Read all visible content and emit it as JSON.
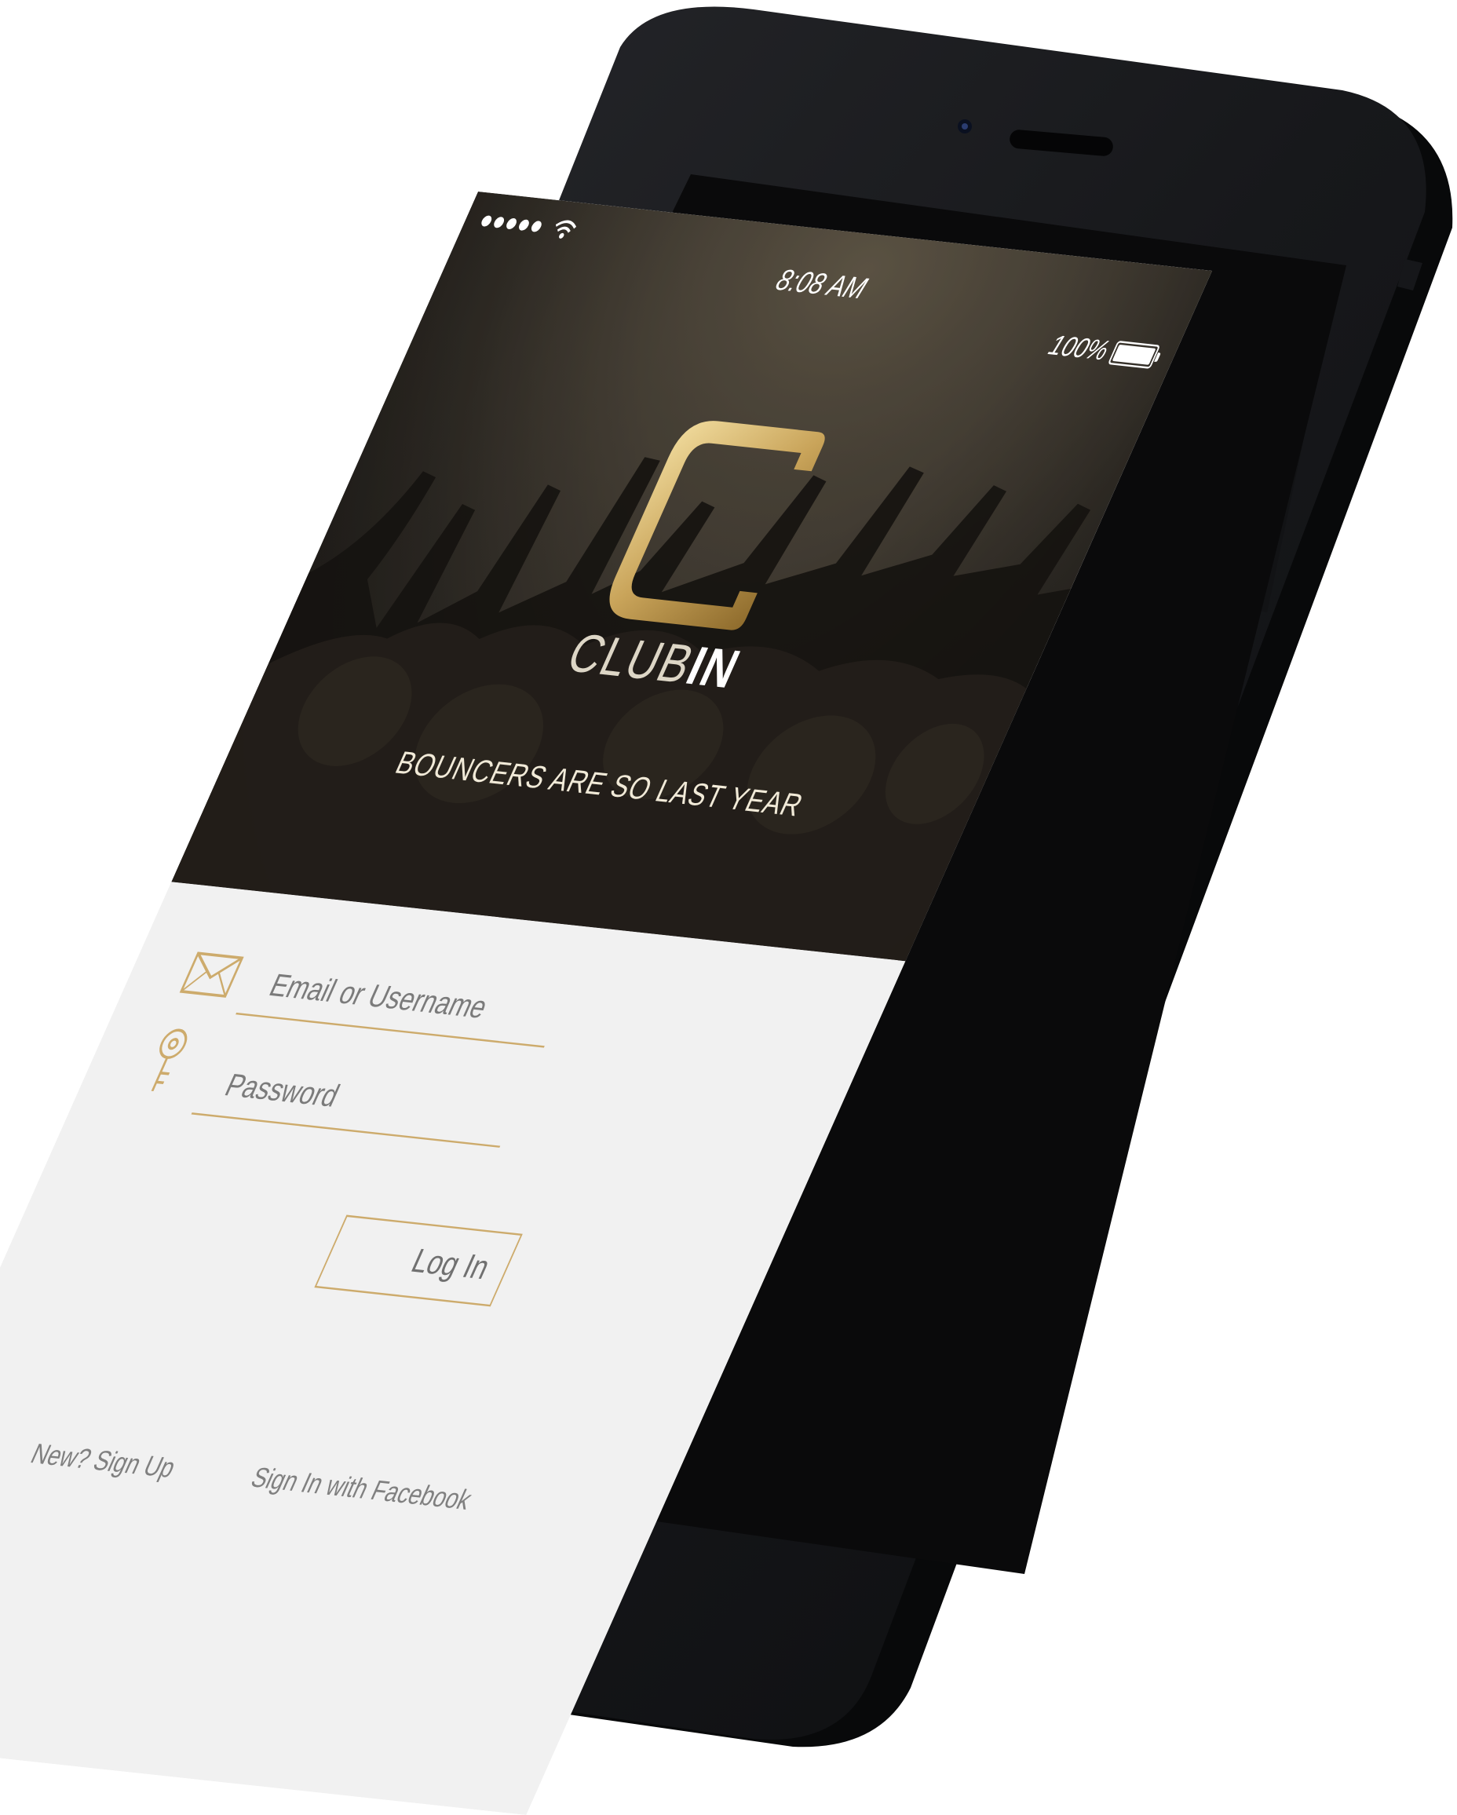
{
  "status_bar": {
    "time": "8:08 AM",
    "battery_percent": "100%",
    "signal_bars": 5,
    "wifi_icon": "wifi-icon",
    "battery_icon": "battery-icon"
  },
  "hero": {
    "brand_light": "CLUB",
    "brand_bold": "IN",
    "tagline": "BOUNCERS ARE SO LAST YEAR",
    "logo_icon": "club-c-logo-icon"
  },
  "login_form": {
    "email": {
      "placeholder": "Email or Username",
      "value": "",
      "icon": "envelope-icon"
    },
    "password": {
      "placeholder": "Password",
      "value": "",
      "icon": "key-icon"
    },
    "login_label": "Log In"
  },
  "footer_links": {
    "signup_label": "New? Sign Up",
    "facebook_label": "Sign In with Facebook"
  },
  "colors": {
    "accent_gold": "#cdab6c",
    "phone_body": "#1b1c1f",
    "form_background": "#f1f1f1",
    "muted_text": "#7b7b7b"
  }
}
